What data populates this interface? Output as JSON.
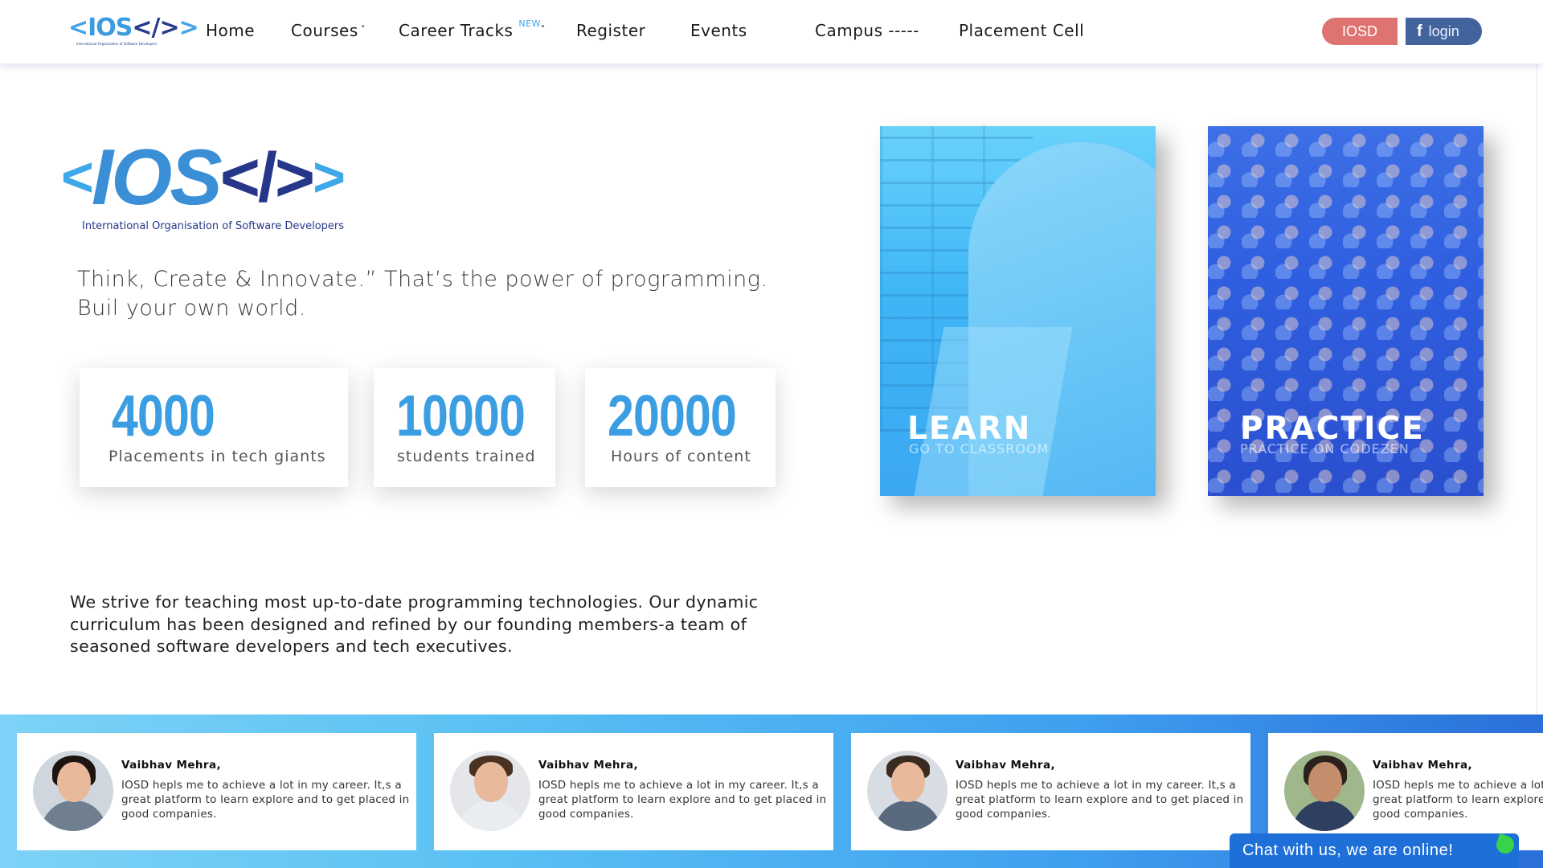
{
  "navbar": {
    "logo": {
      "mark_left": "<",
      "mark_ios": "IOS",
      "mark_code": "</>",
      "mark_right": ">",
      "tagline": "International Organisation of Software Developers"
    },
    "items": [
      {
        "label": "Home"
      },
      {
        "label": "Courses",
        "caret": "˅"
      },
      {
        "label": "Career Tracks",
        "badge": "NEW",
        "caret": "˅"
      },
      {
        "label": "Register"
      },
      {
        "label": "Events"
      },
      {
        "label": "Campus -----"
      },
      {
        "label": "Placement Cell"
      }
    ],
    "iosd_button": "IOSD",
    "login_button": {
      "icon": "f",
      "label": "login"
    }
  },
  "hero": {
    "logo": {
      "left": "<",
      "ios": "IOS",
      "code": "</>",
      "right": ">",
      "tagline": "International Organisation of Software Developers"
    },
    "headline_line1": "Think, Create & Innovate.” That’s the power of programming.",
    "headline_line2": "Buil your own world.",
    "stats": [
      {
        "number": "4000",
        "label": "Placements in tech giants"
      },
      {
        "number": "10000",
        "label": "students trained"
      },
      {
        "number": "20000",
        "label": "Hours of content"
      }
    ]
  },
  "promos": [
    {
      "title": "LEARN",
      "subtitle": "GO TO CLASSROOM",
      "color": "#3fb6f6"
    },
    {
      "title": "PRACTICE",
      "subtitle": "PRACTICE ON CODEZEN",
      "color": "#2a63df"
    }
  ],
  "description": "We strive for teaching most up-to-date programming technologies. Our dynamic curriculum has been designed and refined by our founding members-a team of seasoned software developers and tech executives.",
  "testimonials": [
    {
      "name": "Vaibhav Mehra,",
      "text": "IOSD hepls me to achieve a lot in my career. It,s a great platform to learn explore and to get placed in good companies."
    },
    {
      "name": "Vaibhav Mehra,",
      "text": "IOSD hepls me to achieve a lot in my career. It,s a great platform to learn explore and to get placed in good companies."
    },
    {
      "name": "Vaibhav Mehra,",
      "text": "IOSD hepls me to achieve a lot in my career. It,s a great platform to learn explore and to get placed in good companies."
    },
    {
      "name": "Vaibhav Mehra,",
      "text": "IOSD hepls me to achieve a lot in my career. It,s a great platform to learn explore and to get placed in good companies."
    }
  ],
  "chat": {
    "label": "Chat with us, we are online!"
  },
  "colors": {
    "brand_blue": "#3b9ee2",
    "brand_navy": "#26378a",
    "iosd_button": "#de7472",
    "login_button": "#42639c",
    "chat": "#1f6fd8"
  }
}
